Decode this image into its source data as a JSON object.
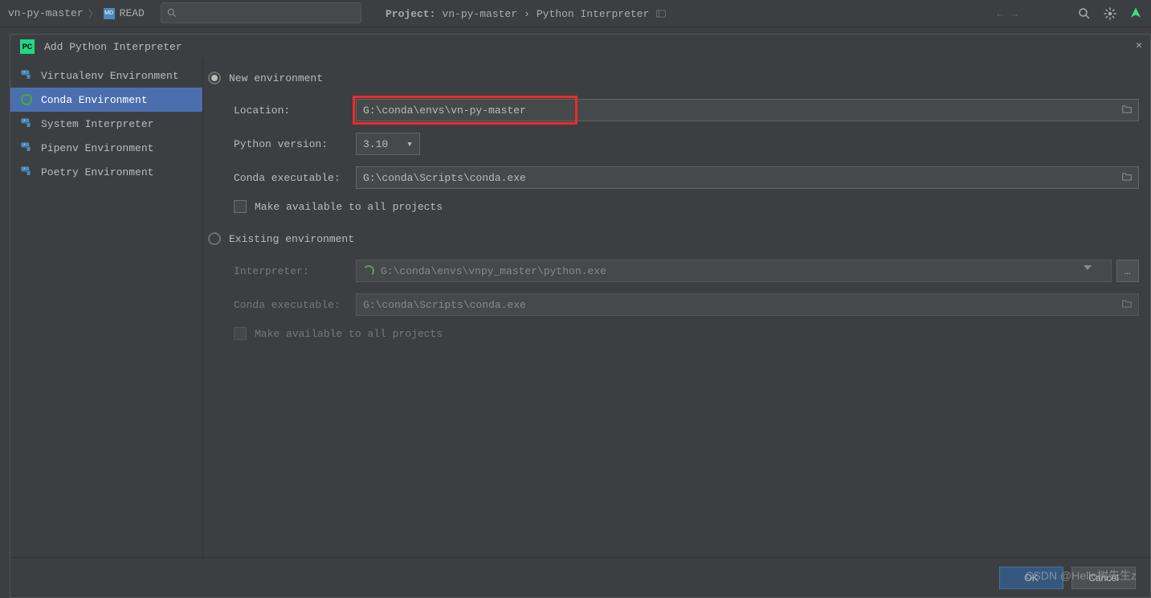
{
  "window": {
    "breadcrumb_project": "vn-py-master",
    "breadcrumb_file": "READ",
    "project_label": "Project:",
    "project_name": "vn-py-master",
    "project_sep": "›",
    "project_section": "Python Interpreter"
  },
  "dialog": {
    "title": "Add Python Interpreter"
  },
  "sidebar": {
    "items": [
      {
        "label": "Virtualenv Environment"
      },
      {
        "label": "Conda Environment"
      },
      {
        "label": "System Interpreter"
      },
      {
        "label": "Pipenv Environment"
      },
      {
        "label": "Poetry Environment"
      }
    ]
  },
  "form": {
    "radio_new": "New environment",
    "radio_existing": "Existing environment",
    "location_label": "Location:",
    "location_value": "G:\\conda\\envs\\vn-py-master",
    "pyversion_label": "Python version:",
    "pyversion_value": "3.10",
    "conda_exec_label": "Conda executable:",
    "conda_exec_value": "G:\\conda\\Scripts\\conda.exe",
    "make_available": "Make available to all projects",
    "interpreter_label": "Interpreter:",
    "interpreter_value": "G:\\conda\\envs\\vnpy_master\\python.exe",
    "conda_exec_value2": "G:\\conda\\Scripts\\conda.exe"
  },
  "footer": {
    "ok": "OK",
    "cancel": "Cancel"
  },
  "watermark": "CSDN @Hello树先生z"
}
